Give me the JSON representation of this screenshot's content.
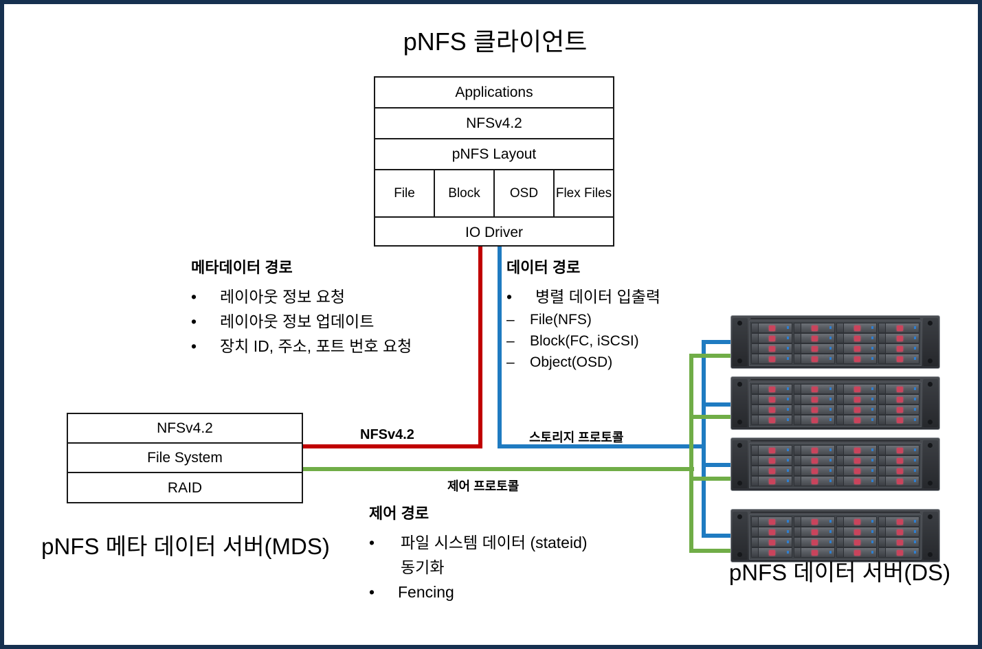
{
  "client": {
    "title": "pNFS 클라이언트",
    "rows": [
      {
        "label": "Applications"
      },
      {
        "label": "NFSv4.2"
      },
      {
        "label": "pNFS Layout"
      }
    ],
    "layout_types": [
      "File",
      "Block",
      "OSD",
      "Flex Files"
    ],
    "io_driver": "IO Driver"
  },
  "mds": {
    "title": "pNFS 메타 데이터 서버(MDS)",
    "rows": [
      "NFSv4.2",
      "File System",
      "RAID"
    ]
  },
  "ds": {
    "title": "pNFS 데이터 서버(DS)",
    "chassis_count": 4,
    "bay_rows": 4,
    "bay_cols": 4
  },
  "metadata_path": {
    "heading": "메타데이터 경로",
    "items": [
      "레이아웃 정보 요청",
      "레이아웃 정보 업데이트",
      "장치 ID, 주소, 포트 번호 요청"
    ],
    "bullet": "•"
  },
  "data_path": {
    "heading": "데이터 경로",
    "items": [
      "병렬 데이터 입출력"
    ],
    "bullet": "•",
    "sub_bullet": "–",
    "sub_items": [
      "File(NFS)",
      "Block(FC, iSCSI)",
      "Object(OSD)"
    ]
  },
  "control_path": {
    "heading": "제어 경로",
    "items": [
      "파일 시스템 데이터 (stateid) 동기화",
      "Fencing"
    ],
    "bullet": "•"
  },
  "link_labels": {
    "metadata_protocol": "NFSv4.2",
    "storage_protocol": "스토리지 프로토콜",
    "control_protocol": "제어 프로토콜"
  },
  "colors": {
    "metadata_line": "#C00000",
    "data_line": "#1F7BC1",
    "control_line": "#70AD47",
    "border": "#16304F",
    "box_stroke": "#181818"
  }
}
